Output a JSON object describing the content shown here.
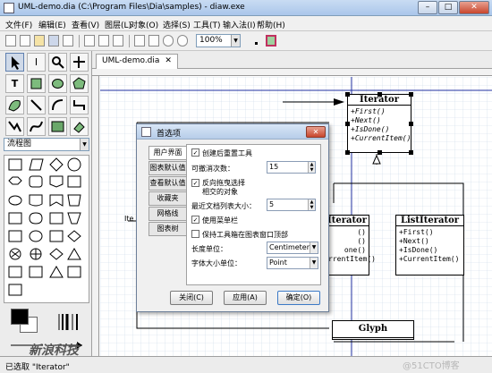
{
  "window": {
    "title": "UML-demo.dia (C:\\Program Files\\Dia\\samples) - diaw.exe",
    "minimize": "–",
    "maximize": "□",
    "close": "✕"
  },
  "menu": [
    "文件(F)",
    "编辑(E)",
    "查看(V)",
    "图层(L)",
    "对象(O)",
    "选择(S)",
    "工具(T)",
    "输入法(I)",
    "帮助(H)"
  ],
  "toolbar": {
    "zoom_value": "100%"
  },
  "left_panel": {
    "sheet_selector": "流程图",
    "watermark_logo": "新浪科技"
  },
  "tab": {
    "label": "UML-demo.dia",
    "close": "✕"
  },
  "canvas": {
    "edge_text": "Ite",
    "classes": {
      "iterator": {
        "name": "Iterator",
        "ops": [
          "+First()",
          "+Next()",
          "+IsDone()",
          "+CurrentItem()"
        ]
      },
      "iterator2": {
        "name": "Iterator",
        "ops": [
          "()",
          "()",
          "one()",
          "rrentItem()"
        ]
      },
      "list_iterator": {
        "name": "ListIterator",
        "ops": [
          "+First()",
          "+Next()",
          "+IsDone()",
          "+CurrentItem()"
        ]
      },
      "glyph": {
        "name": "Glyph"
      }
    }
  },
  "dialog": {
    "title": "首选项",
    "close": "✕",
    "tabs": [
      "用户界面",
      "图表默认值",
      "查看默认值",
      "收藏夹",
      "网格线",
      "图表树"
    ],
    "reset_tools_label": "创建后重置工具",
    "undo_label": "可撤消次数：",
    "undo_value": "15",
    "reverse_drag_label": "反向拖曳选择",
    "reverse_drag_label2": "相交的对象",
    "recent_files_label": "最近文档列表大小：",
    "recent_files_value": "5",
    "menubar_label": "使用菜单栏",
    "keep_tools_label": "保持工具箱在图表窗口顶部",
    "length_unit_label": "长度单位：",
    "length_unit_value": "Centimeter",
    "font_unit_label": "字体大小单位：",
    "font_unit_value": "Point",
    "close_button": "关闭(C)",
    "apply_button": "应用(A)",
    "ok_button": "确定(O)"
  },
  "status": {
    "text": "已选取 \"Iterator\"",
    "watermark": "@51CTO博客"
  }
}
